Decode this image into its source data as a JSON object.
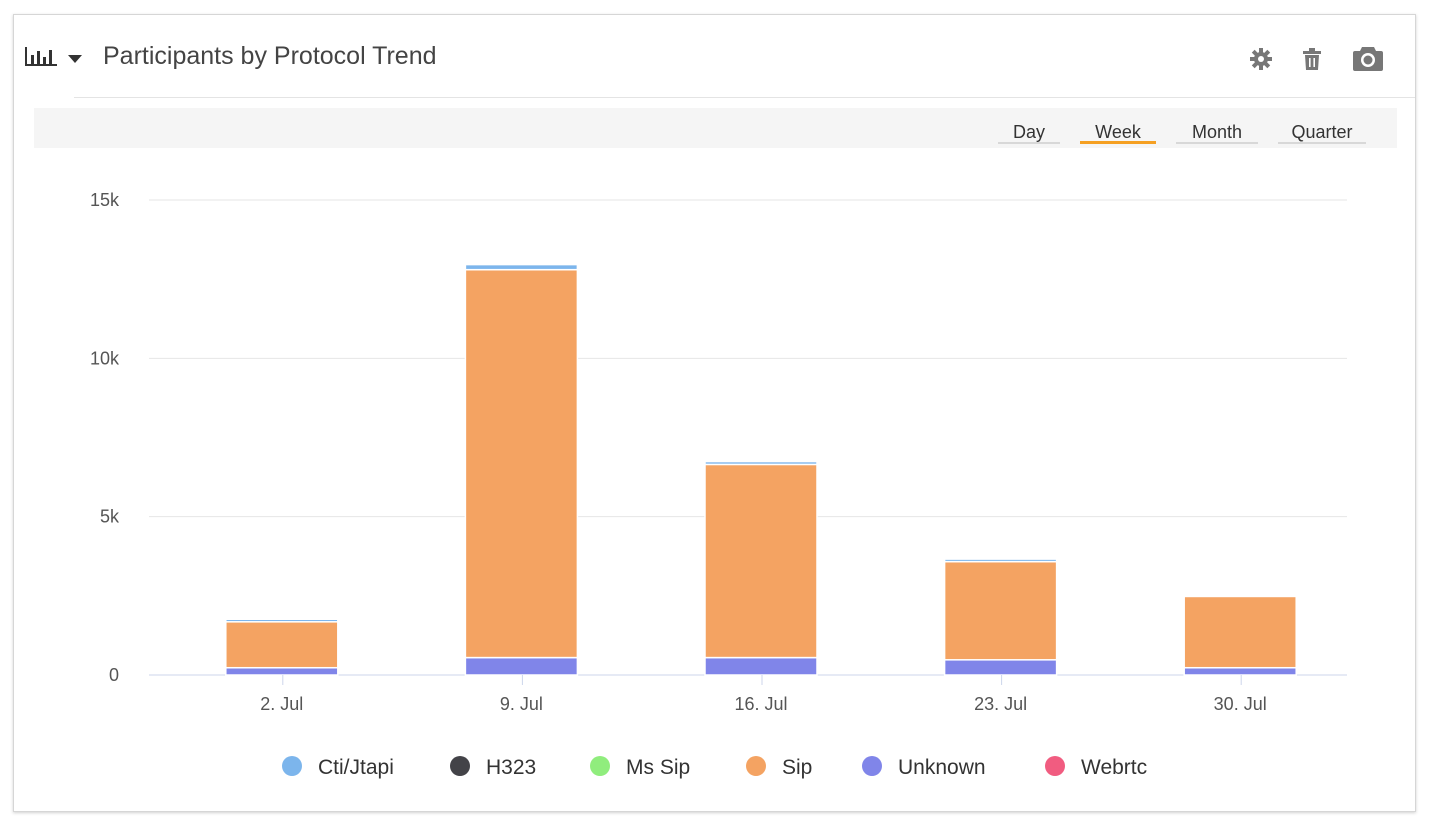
{
  "header": {
    "title": "Participants by Protocol Trend",
    "icons": [
      "bar-chart-icon",
      "caret-down-icon",
      "gear-icon",
      "trash-icon",
      "camera-icon"
    ]
  },
  "range_buttons": [
    {
      "label": "Day",
      "active": false
    },
    {
      "label": "Week",
      "active": true
    },
    {
      "label": "Month",
      "active": false
    },
    {
      "label": "Quarter",
      "active": false
    }
  ],
  "colors": {
    "accent": "#f5a023",
    "cti_jtapi": "#7cb5ec",
    "h323": "#434348",
    "ms_sip": "#90ed7d",
    "sip": "#f4a362",
    "unknown": "#8085e9",
    "webrtc": "#f15c80"
  },
  "chart_data": {
    "type": "bar",
    "stacked": true,
    "categories": [
      "2. Jul",
      "9. Jul",
      "16. Jul",
      "23. Jul",
      "30. Jul"
    ],
    "y_ticks": [
      "0",
      "5k",
      "10k",
      "15k"
    ],
    "ylim": [
      0,
      15000
    ],
    "grid": true,
    "legend_position": "bottom",
    "series": [
      {
        "name": "Cti/Jtapi",
        "color": "#7cb5ec",
        "values": [
          80,
          160,
          90,
          80,
          0
        ]
      },
      {
        "name": "H323",
        "color": "#434348",
        "values": [
          0,
          0,
          0,
          0,
          0
        ]
      },
      {
        "name": "Ms Sip",
        "color": "#90ed7d",
        "values": [
          0,
          0,
          0,
          0,
          0
        ]
      },
      {
        "name": "Sip",
        "color": "#f4a362",
        "values": [
          1450,
          12250,
          6100,
          3100,
          2250
        ]
      },
      {
        "name": "Unknown",
        "color": "#8085e9",
        "values": [
          230,
          550,
          550,
          480,
          230
        ]
      },
      {
        "name": "Webrtc",
        "color": "#f15c80",
        "values": [
          0,
          0,
          0,
          0,
          0
        ]
      }
    ]
  }
}
